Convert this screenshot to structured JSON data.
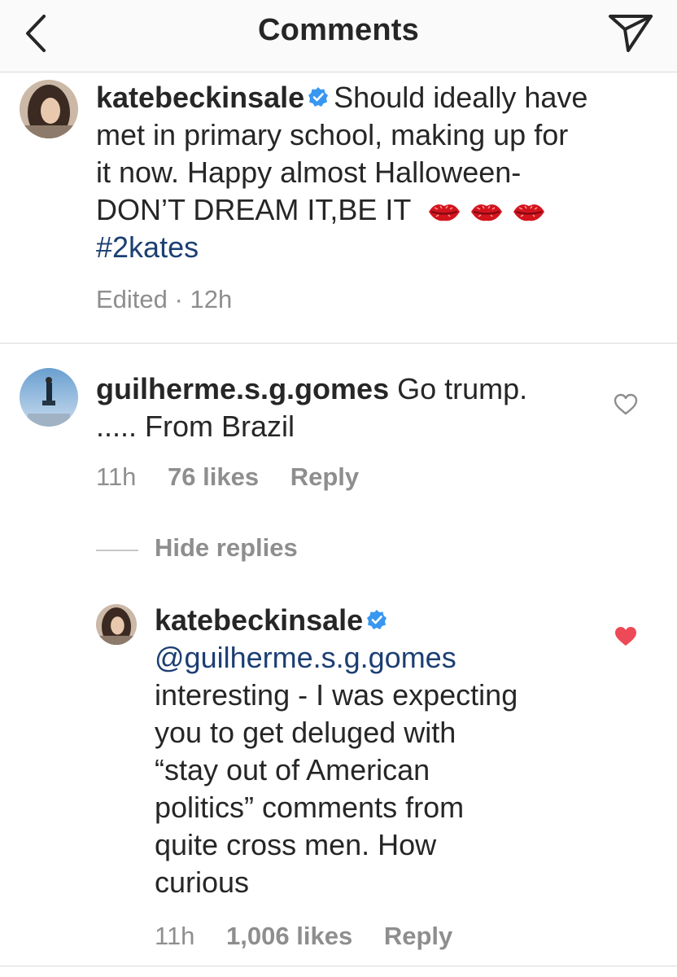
{
  "header": {
    "title": "Comments"
  },
  "caption": {
    "username": "katebeckinsale",
    "lines": [
      "Should ideally have",
      "met in primary school, making up for",
      "it now. Happy almost Halloween-",
      "DON’T DREAM IT,BE IT"
    ],
    "hashtag": "#2kates",
    "edited": "Edited",
    "separator": "·",
    "time": "12h",
    "emoji": [
      "kiss-mark",
      "kiss-mark",
      "kiss-mark"
    ]
  },
  "comment": {
    "username": "guilherme.s.g.gomes",
    "text_line1": "Go trump.",
    "text_line2": "..... From Brazil",
    "time": "11h",
    "likes": "76 likes",
    "reply": "Reply",
    "hide_replies": "Hide replies"
  },
  "reply": {
    "username": "katebeckinsale",
    "mention": "@guilherme.s.g.gomes",
    "lines": [
      "interesting - I was expecting",
      "you to get deluged with",
      "“stay out of American",
      "politics” comments from",
      "quite cross men. How",
      "curious"
    ],
    "time": "11h",
    "likes": "1,006 likes",
    "reply": "Reply",
    "liked": true
  },
  "colors": {
    "link": "#1c3f73",
    "verified": "#3897f0",
    "heart_liked": "#ed4956",
    "meta": "#8e8e8e"
  }
}
